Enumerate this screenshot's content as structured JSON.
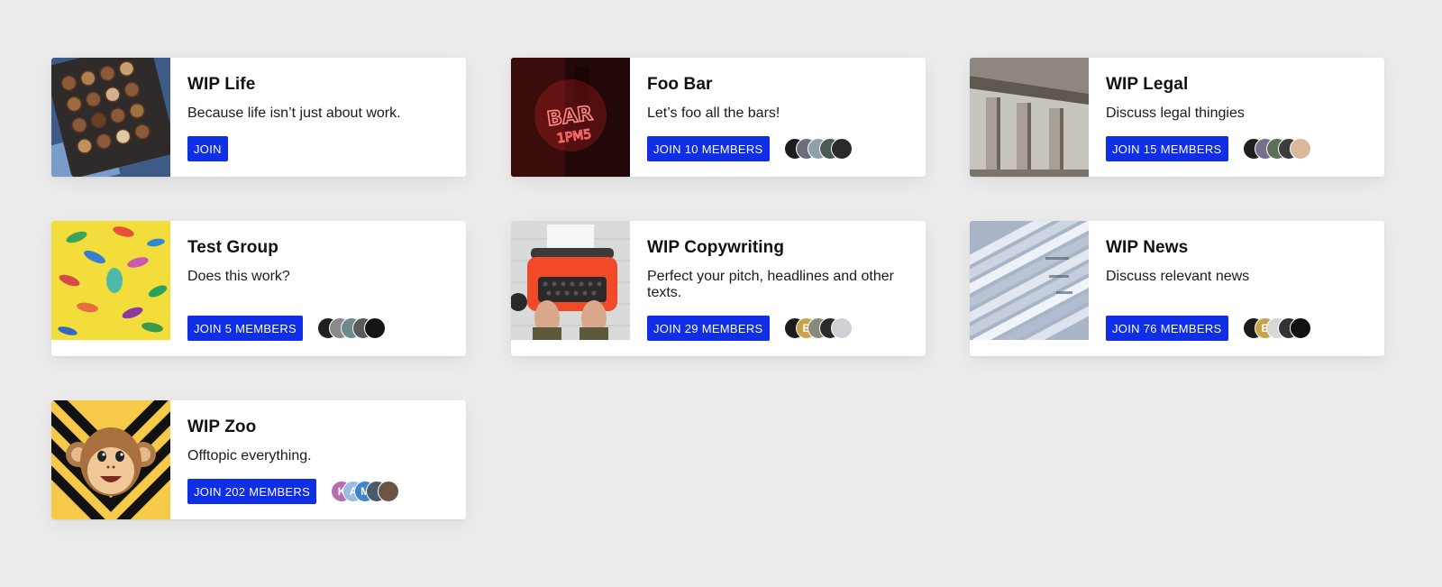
{
  "groups": [
    {
      "title": "WIP Life",
      "description": "Because life isn’t just about work.",
      "join_label": "JOIN",
      "image": "chocolates-photo",
      "avatars": []
    },
    {
      "title": "Foo Bar",
      "description": "Let’s foo all the bars!",
      "join_label": "JOIN 10 MEMBERS",
      "image": "neon-bar-sign-photo",
      "avatars": [
        {
          "color": "#1c1c1c",
          "text": ""
        },
        {
          "color": "#6b6f7a",
          "text": ""
        },
        {
          "color": "#8fa1a8",
          "text": ""
        },
        {
          "color": "#4a5a55",
          "text": ""
        },
        {
          "color": "#2a2a2a",
          "text": ""
        }
      ]
    },
    {
      "title": "WIP Legal",
      "description": "Discuss legal thingies",
      "join_label": "JOIN 15 MEMBERS",
      "image": "courthouse-columns-photo",
      "avatars": [
        {
          "color": "#1f1f1f",
          "text": ""
        },
        {
          "color": "#7a6e8e",
          "text": ""
        },
        {
          "color": "#5b6f5a",
          "text": ""
        },
        {
          "color": "#3c3c3c",
          "text": ""
        },
        {
          "color": "#d9b99a",
          "text": ""
        }
      ]
    },
    {
      "title": "Test Group",
      "description": "Does this work?",
      "join_label": "JOIN 5 MEMBERS",
      "image": "toy-dinosaurs-photo",
      "avatars": [
        {
          "color": "#1f1f1f",
          "text": ""
        },
        {
          "color": "#8a8a8a",
          "text": ""
        },
        {
          "color": "#6d8a8c",
          "text": ""
        },
        {
          "color": "#5a5a5a",
          "text": ""
        },
        {
          "color": "#141414",
          "text": ""
        }
      ]
    },
    {
      "title": "WIP Copywriting",
      "description": "Perfect your pitch, headlines and other texts.",
      "join_label": "JOIN 29 MEMBERS",
      "image": "typewriter-photo",
      "avatars": [
        {
          "color": "#1c1c1c",
          "text": ""
        },
        {
          "color": "#c9a24a",
          "text": "E"
        },
        {
          "color": "#8a8a7a",
          "text": ""
        },
        {
          "color": "#2b2b2b",
          "text": ""
        },
        {
          "color": "#cfcfd6",
          "text": ""
        }
      ]
    },
    {
      "title": "WIP News",
      "description": "Discuss relevant news",
      "join_label": "JOIN 76 MEMBERS",
      "image": "newspapers-photo",
      "avatars": [
        {
          "color": "#1c1c1c",
          "text": ""
        },
        {
          "color": "#c9a24a",
          "text": "E"
        },
        {
          "color": "#d7d7d7",
          "text": ""
        },
        {
          "color": "#333333",
          "text": ""
        },
        {
          "color": "#111111",
          "text": ""
        }
      ]
    },
    {
      "title": "WIP Zoo",
      "description": "Offtopic everything.",
      "join_label": "JOIN 202 MEMBERS",
      "image": "monkey-emoji",
      "avatars": [
        {
          "color": "#b56fb0",
          "text": "K"
        },
        {
          "color": "#9bbbe0",
          "text": "A"
        },
        {
          "color": "#3d86c6",
          "text": "M"
        },
        {
          "color": "#4b5a6a",
          "text": ""
        },
        {
          "color": "#6b5444",
          "text": ""
        }
      ]
    }
  ]
}
